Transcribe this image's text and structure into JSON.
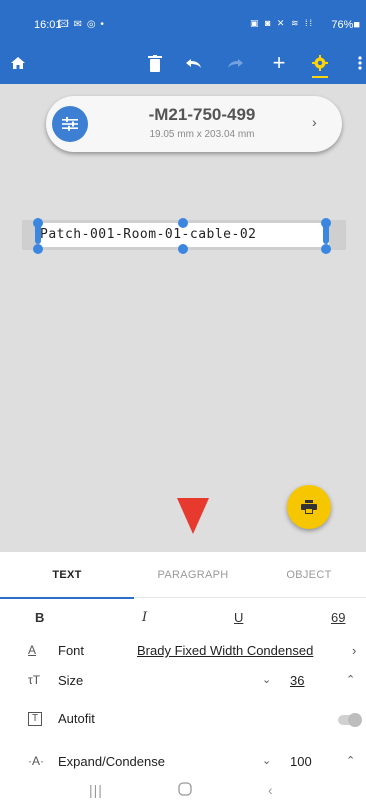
{
  "status_bar": {
    "time": "16:01",
    "left_icons": "🖾 ✉ ◎ •",
    "right_icons": "▣ ◙ ✕ ≋ ⁞⁞",
    "battery": "76%■"
  },
  "toolbar": {
    "home_icon": "home-icon",
    "delete_icon": "trash-icon",
    "undo_icon": "undo-icon",
    "redo_icon": "redo-icon",
    "add_icon": "plus-icon",
    "settings_icon": "gear-icon",
    "more_icon": "more-vert-icon"
  },
  "label_card": {
    "part_number": "-M21-750-499",
    "dimensions": "19.05 mm x 203.04 mm"
  },
  "label_text": "Patch-001-Room-01-cable-02",
  "tabs": [
    {
      "label": "TEXT",
      "active": true
    },
    {
      "label": "PARAGRAPH",
      "active": false
    },
    {
      "label": "OBJECT",
      "active": false
    }
  ],
  "format_buttons": {
    "bold": "B",
    "italic": "I",
    "underline": "U",
    "wrap": "69"
  },
  "properties": {
    "font_label": "Font",
    "font_value": "Brady Fixed Width Condensed",
    "size_label": "Size",
    "size_value": "36",
    "autofit_label": "Autofit",
    "autofit_on": false,
    "expand_label": "Expand/Condense",
    "expand_value": "100"
  },
  "colors": {
    "app_bar": "#2b6fc9",
    "canvas": "#dedede",
    "print_fab": "#f6c700",
    "selection": "#3b87e0",
    "annotation_arrow": "#e8392f"
  }
}
